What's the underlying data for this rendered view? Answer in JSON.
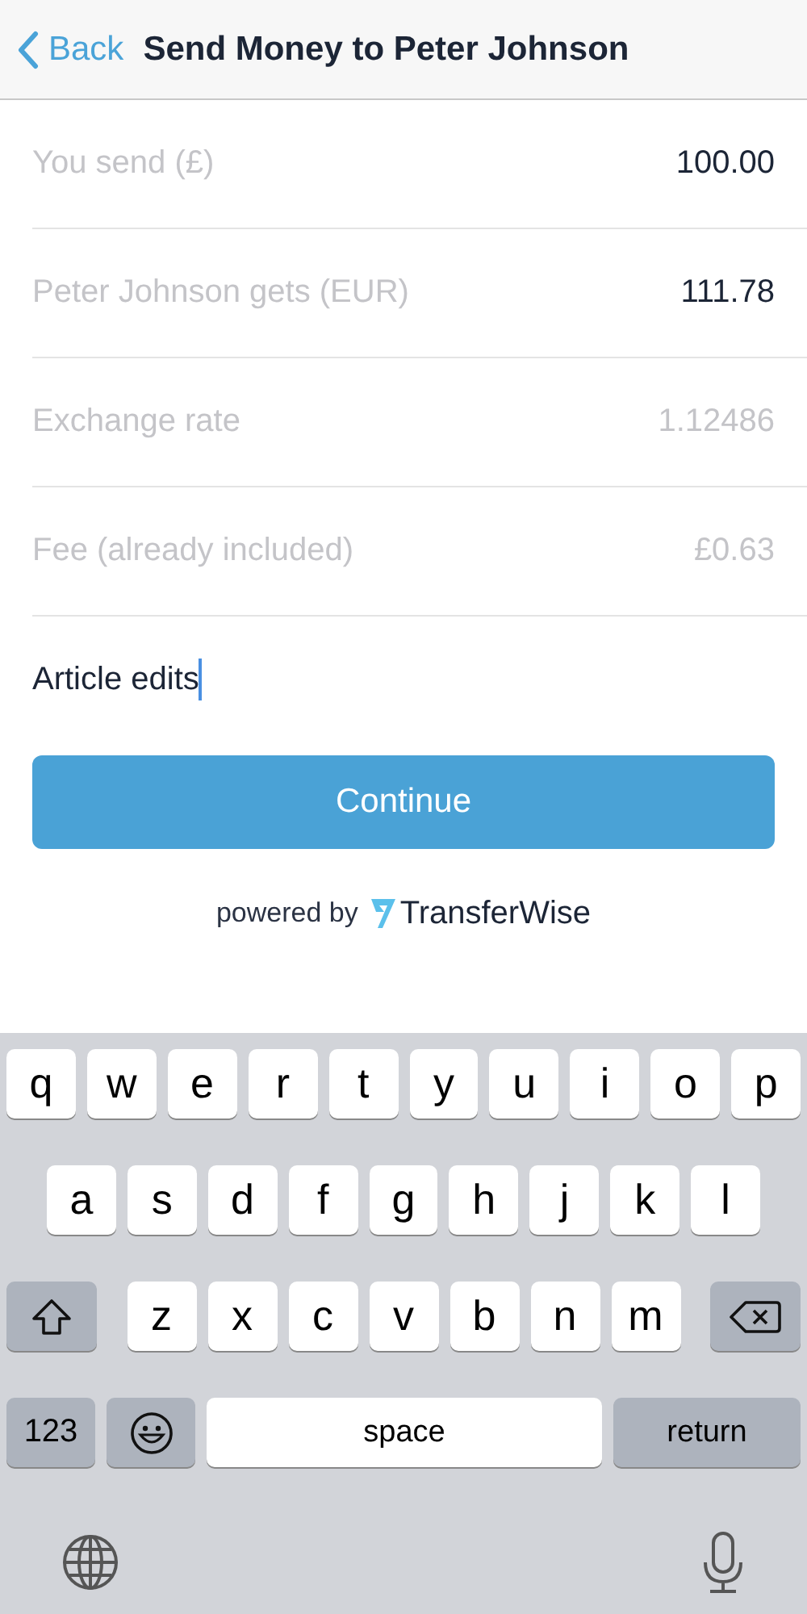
{
  "nav": {
    "back": "Back",
    "title": "Send Money to Peter Johnson"
  },
  "rows": [
    {
      "label": "You send (£)",
      "value": "100.00",
      "emphasized": true
    },
    {
      "label": "Peter Johnson gets (EUR)",
      "value": "111.78",
      "emphasized": true
    },
    {
      "label": "Exchange rate",
      "value": "1.12486",
      "emphasized": false
    },
    {
      "label": "Fee (already included)",
      "value": "£0.63",
      "emphasized": false
    }
  ],
  "note": {
    "value": "Article edits",
    "focused": true
  },
  "continue_button": "Continue",
  "powered_by": {
    "text": "powered by",
    "brand": "TransferWise"
  },
  "keyboard": {
    "rows": [
      [
        "q",
        "w",
        "e",
        "r",
        "t",
        "y",
        "u",
        "i",
        "o",
        "p"
      ],
      [
        "a",
        "s",
        "d",
        "f",
        "g",
        "h",
        "j",
        "k",
        "l"
      ],
      [
        "z",
        "x",
        "c",
        "v",
        "b",
        "n",
        "m"
      ]
    ],
    "numbers_key": "123",
    "space_key": "space",
    "return_key": "return"
  }
}
